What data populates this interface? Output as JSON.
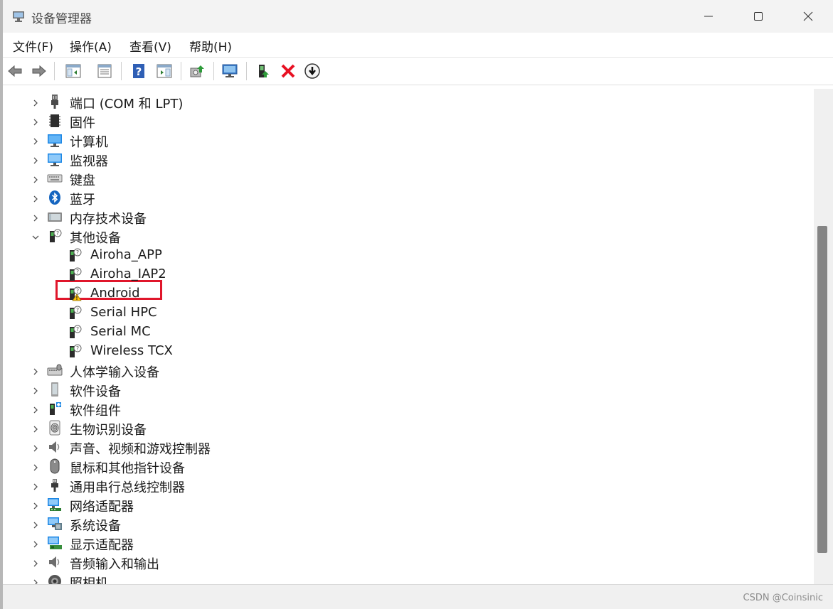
{
  "window": {
    "title": "设备管理器",
    "minimize_icon": "minimize-icon",
    "maximize_icon": "maximize-icon",
    "close_icon": "close-icon"
  },
  "menu": {
    "items": [
      {
        "label": "文件(F)"
      },
      {
        "label": "操作(A)"
      },
      {
        "label": "查看(V)"
      },
      {
        "label": "帮助(H)"
      }
    ]
  },
  "toolbar": {
    "buttons": [
      {
        "icon": "back-arrow-icon"
      },
      {
        "icon": "forward-arrow-icon"
      },
      {
        "icon": "show-hide-console-tree-icon"
      },
      {
        "icon": "properties-icon"
      },
      {
        "icon": "help-icon"
      },
      {
        "icon": "action-pane-icon"
      },
      {
        "icon": "update-driver-icon"
      },
      {
        "icon": "scan-hardware-changes-icon"
      },
      {
        "icon": "enable-device-icon"
      },
      {
        "icon": "uninstall-device-icon"
      },
      {
        "icon": "disable-device-icon"
      }
    ]
  },
  "tree": {
    "nodes": [
      {
        "label": "端口 (COM 和 LPT)",
        "icon": "port-connector-icon",
        "expanded": false
      },
      {
        "label": "固件",
        "icon": "firmware-chip-icon",
        "expanded": false
      },
      {
        "label": "计算机",
        "icon": "computer-monitor-icon",
        "expanded": false
      },
      {
        "label": "监视器",
        "icon": "monitor-icon",
        "expanded": false
      },
      {
        "label": "键盘",
        "icon": "keyboard-icon",
        "expanded": false
      },
      {
        "label": "蓝牙",
        "icon": "bluetooth-icon",
        "expanded": false
      },
      {
        "label": "内存技术设备",
        "icon": "memory-device-icon",
        "expanded": false
      },
      {
        "label": "其他设备",
        "icon": "unknown-device-icon",
        "expanded": true
      },
      {
        "label": "Airoha_APP",
        "icon": "unknown-device-icon",
        "child": true
      },
      {
        "label": "Airoha_IAP2",
        "icon": "unknown-device-icon",
        "child": true
      },
      {
        "label": "Android",
        "icon": "warning-device-icon",
        "child": true,
        "highlighted": true
      },
      {
        "label": "Serial HPC",
        "icon": "unknown-device-icon",
        "child": true
      },
      {
        "label": "Serial MC",
        "icon": "unknown-device-icon",
        "child": true
      },
      {
        "label": "Wireless TCX",
        "icon": "unknown-device-icon",
        "child": true
      },
      {
        "label": "人体学输入设备",
        "icon": "hid-device-icon",
        "expanded": false
      },
      {
        "label": "软件设备",
        "icon": "software-device-icon",
        "expanded": false
      },
      {
        "label": "软件组件",
        "icon": "software-component-icon",
        "expanded": false
      },
      {
        "label": "生物识别设备",
        "icon": "fingerprint-icon",
        "expanded": false
      },
      {
        "label": "声音、视频和游戏控制器",
        "icon": "speaker-icon",
        "expanded": false
      },
      {
        "label": "鼠标和其他指针设备",
        "icon": "mouse-icon",
        "expanded": false
      },
      {
        "label": "通用串行总线控制器",
        "icon": "usb-plug-icon",
        "expanded": false
      },
      {
        "label": "网络适配器",
        "icon": "network-adapter-icon",
        "expanded": false
      },
      {
        "label": "系统设备",
        "icon": "system-device-icon",
        "expanded": false
      },
      {
        "label": "显示适配器",
        "icon": "display-adapter-icon",
        "expanded": false
      },
      {
        "label": "音频输入和输出",
        "icon": "audio-io-icon",
        "expanded": false
      },
      {
        "label": "照相机",
        "icon": "camera-icon",
        "expanded": false
      }
    ]
  },
  "statusbar": {
    "watermark": "CSDN @Coinsinic"
  },
  "colors": {
    "highlight_border": "#e0162b",
    "scroll_thumb": "#858585",
    "uninstall_red": "#e81123"
  }
}
